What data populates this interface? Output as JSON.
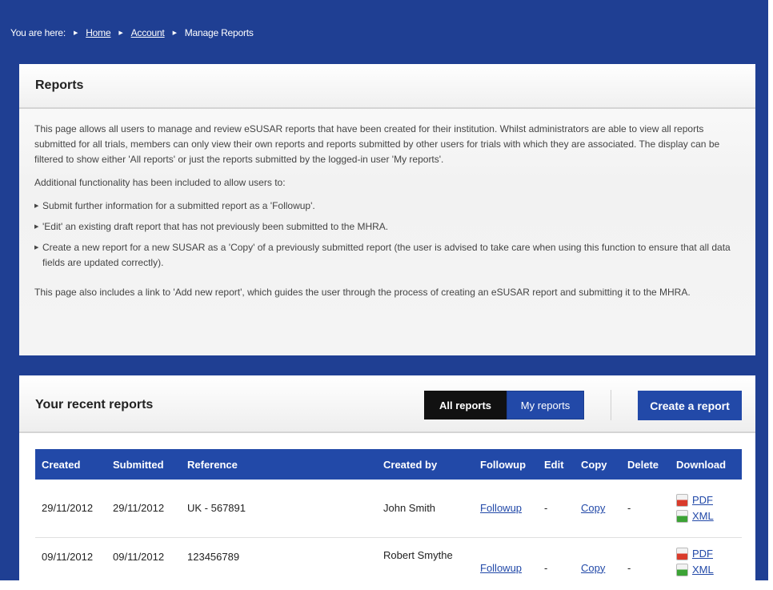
{
  "breadcrumb": {
    "prefix": "You are here:",
    "items": [
      "Home",
      "Account"
    ],
    "current": "Manage Reports"
  },
  "reports_panel": {
    "title": "Reports",
    "para1": "This page allows all users to manage and review eSUSAR reports that have been created for their institution. Whilst administrators are able to view all reports submitted for all trials, members can only view their own reports and reports submitted by other users for trials with which they are associated. The display can be filtered to show either 'All reports' or just the reports submitted by the logged-in user 'My reports'.",
    "para2": "Additional functionality has been included to allow users to:",
    "bullets": [
      "Submit further information for a submitted report as a 'Followup'.",
      "'Edit' an existing draft report that has not previously been submitted to the MHRA.",
      "Create a new report for a new SUSAR as a 'Copy' of a previously submitted report (the user is advised to take care when using this function to ensure that all data fields are updated correctly)."
    ],
    "para3": "This page also includes a link to 'Add new report', which guides the user through the process of creating an eSUSAR report and submitting it to the MHRA."
  },
  "recent": {
    "title": "Your recent reports",
    "all_label": "All reports",
    "my_label": "My reports",
    "create_label": "Create a report",
    "columns": [
      "Created",
      "Submitted",
      "Reference",
      "Created by",
      "Followup",
      "Edit",
      "Copy",
      "Delete",
      "Download"
    ],
    "rows": [
      {
        "created": "29/11/2012",
        "submitted": "29/11/2012",
        "reference": "UK - 567891",
        "created_by": "John Smith",
        "followup": "Followup",
        "edit": "-",
        "copy": "Copy",
        "delete": "-",
        "pdf": "PDF",
        "xml": "XML"
      },
      {
        "created": "09/11/2012",
        "submitted": "09/11/2012",
        "reference": "123456789",
        "created_by": "Robert Smythe",
        "followup": "Followup",
        "edit": "-",
        "copy": "Copy",
        "delete": "-",
        "pdf": "PDF",
        "xml": "XML"
      }
    ]
  },
  "colors": {
    "header_blue": "#1f3f93",
    "button_blue": "#2249a8",
    "active_black": "#111111"
  }
}
